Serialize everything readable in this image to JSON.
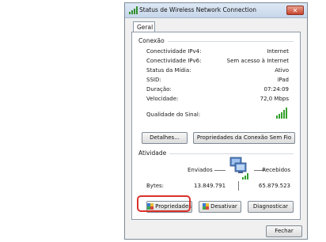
{
  "window": {
    "title": "Status de Wireless Network Connection",
    "close_label": "✕",
    "tab_label": "Geral"
  },
  "connection": {
    "group_label": "Conexão",
    "rows": [
      {
        "label": "Conectividade IPv4:",
        "value": "Internet"
      },
      {
        "label": "Conectividade IPv6:",
        "value": "Sem acesso à Internet"
      },
      {
        "label": "Status da Mídia:",
        "value": "Ativo"
      },
      {
        "label": "SSID:",
        "value": "iPad"
      },
      {
        "label": "Duração:",
        "value": "07:24:09"
      },
      {
        "label": "Velocidade:",
        "value": "72,0 Mbps"
      }
    ],
    "signal_label": "Qualidade do Sinal:",
    "signal_bars": 5,
    "details_button": "Detalhes...",
    "wireless_props_button": "Propriedades da Conexão Sem Fio"
  },
  "activity": {
    "group_label": "Atividade",
    "sent_label": "Enviados",
    "received_label": "Recebidos",
    "bytes_label": "Bytes:",
    "bytes_sent": "13.849.791",
    "bytes_received": "65.879.523"
  },
  "actions": {
    "properties_button": "Propriedades",
    "disable_button": "Desativar",
    "diagnose_button": "Diagnosticar"
  },
  "footer": {
    "close_button": "Fechar"
  },
  "colors": {
    "highlight": "#d9322b",
    "signal": "#34a02c",
    "title_gradient": "#c6d6ea"
  }
}
